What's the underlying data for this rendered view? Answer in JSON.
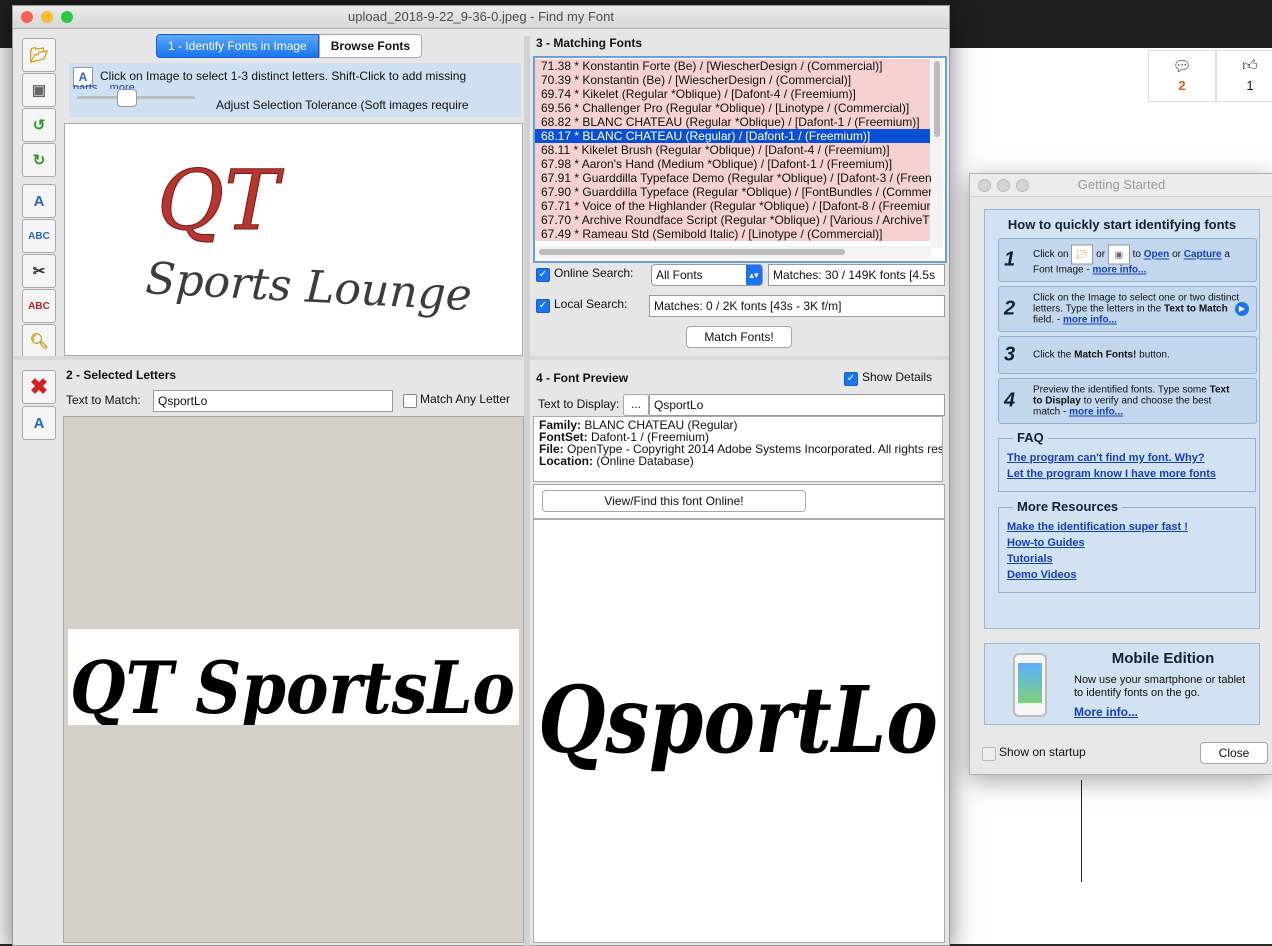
{
  "main_window": {
    "title": "upload_2018-9-22_9-36-0.jpeg - Find my Font",
    "identify": {
      "tab_identify": "1 - Identify Fonts in Image",
      "tab_browse": "Browse Fonts",
      "hint": "Click on Image to select 1-3 distinct letters. Shift-Click to add missing",
      "hint_more": "parts... more",
      "tolerance_label": "Adjust Selection Tolerance (Soft images require",
      "image_logo_monogram": "QT",
      "image_logo_text": "Sports Lounge"
    },
    "selected_letters": {
      "title": "2 - Selected Letters",
      "text_to_match_label": "Text to Match:",
      "text_to_match_value": "QsportLo",
      "match_any_label": "Match Any Letter",
      "preview_text": "QT SportsLo"
    },
    "matching_fonts": {
      "title": "3 - Matching Fonts",
      "rows": [
        "71.38 * Konstantin Forte (Be) / [WiescherDesign / (Commercial)]",
        "70.39 * Konstantin (Be) / [WiescherDesign / (Commercial)]",
        "69.74 * Kikelet (Regular *Oblique) / [Dafont-4 / (Freemium)]",
        "69.56 * Challenger Pro (Regular *Oblique) / [Linotype / (Commercial)]",
        "68.82 * BLANC CHATEAU (Regular *Oblique) / [Dafont-1 / (Freemium)]",
        "68.17 * BLANC CHATEAU (Regular) / [Dafont-1 / (Freemium)]",
        "68.11 * Kikelet Brush (Regular *Oblique) / [Dafont-4 / (Freemium)]",
        "67.98 * Aaron's Hand (Medium *Oblique) / [Dafont-1 / (Freemium)]",
        "67.91 * Guarddilla Typeface Demo (Regular *Oblique) / [Dafont-3 / (Freen",
        "67.90 * Guarddilla Typeface (Regular *Oblique) / [FontBundles / (Commer",
        "67.71 * Voice of the Highlander (Regular *Oblique) / [Dafont-8 / (Freemiur",
        "67.70 * Archive Roundface Script (Regular *Oblique) / [Various / ArchiveT",
        "67.49 * Rameau Std (Semibold Italic) / [Linotype / (Commercial)]"
      ],
      "selected_index": 5,
      "online_search_label": "Online Search:",
      "online_search_select": "All Fonts",
      "online_matches": "Matches: 30 / 149K fonts [4.5s",
      "local_search_label": "Local Search:",
      "local_matches": "Matches: 0 / 2K fonts [43s - 3K f/m]",
      "match_button": "Match Fonts!"
    },
    "font_preview": {
      "title": "4 - Font Preview",
      "show_details_label": "Show Details",
      "text_to_display_label": "Text to Display:",
      "ellipsis_button": "...",
      "text_to_display_value": "QsportLo",
      "family_label": "Family:",
      "family_value": "BLANC CHATEAU (Regular)",
      "fontset_label": "FontSet:",
      "fontset_value": "Dafont-1 / (Freemium)",
      "file_label": "File:",
      "file_value": "OpenType  - Copyright 2014 Adobe Systems Incorporated. All rights res",
      "location_label": "Location:",
      "location_value": "(Online Database)",
      "view_online_button": "View/Find this font Online!",
      "preview_text": "QsportLo"
    }
  },
  "background_page": {
    "comments_count": "2",
    "likes_count": "1"
  },
  "getting_started": {
    "title": "Getting Started",
    "heading": "How to quickly start identifying fonts",
    "steps": [
      {
        "n": "1",
        "a": "Click on",
        "b": "or",
        "c": "to",
        "open": "Open",
        "or2": "or",
        "capture": "Capture",
        "d": "a Font Image",
        "more": "more info..."
      },
      {
        "n": "2",
        "a": "Click on the Image to select one or two distinct letters.   Type the letters in the",
        "b": "Text to Match",
        "c": "field.",
        "more": "more info..."
      },
      {
        "n": "3",
        "a": "Click the",
        "b": "Match Fonts!",
        "c": "button."
      },
      {
        "n": "4",
        "a": "Preview the identified fonts. Type some",
        "b": "Text to Display",
        "c": "to verify and choose the best match",
        "more": "more info..."
      }
    ],
    "faq_title": "FAQ",
    "faq_links": [
      "The program can't find my font. Why?",
      "Let the program know I have more fonts"
    ],
    "resources_title": "More Resources",
    "resource_links": [
      "Make the identification super fast !",
      "How-to Guides",
      "Tutorials",
      "Demo Videos"
    ],
    "mobile_title": "Mobile Edition",
    "mobile_text": "Now use your smartphone or tablet to identify fonts on the go.",
    "mobile_more": "More info...",
    "show_on_startup_label": "Show on startup",
    "close_button": "Close"
  },
  "colors": {
    "accent": "#1a73f0",
    "list_row_bg": "#f5d1d1",
    "selected_row": "#0a4fd6",
    "logo_red": "#b8342e",
    "logo_dark": "#3c3c3c"
  }
}
